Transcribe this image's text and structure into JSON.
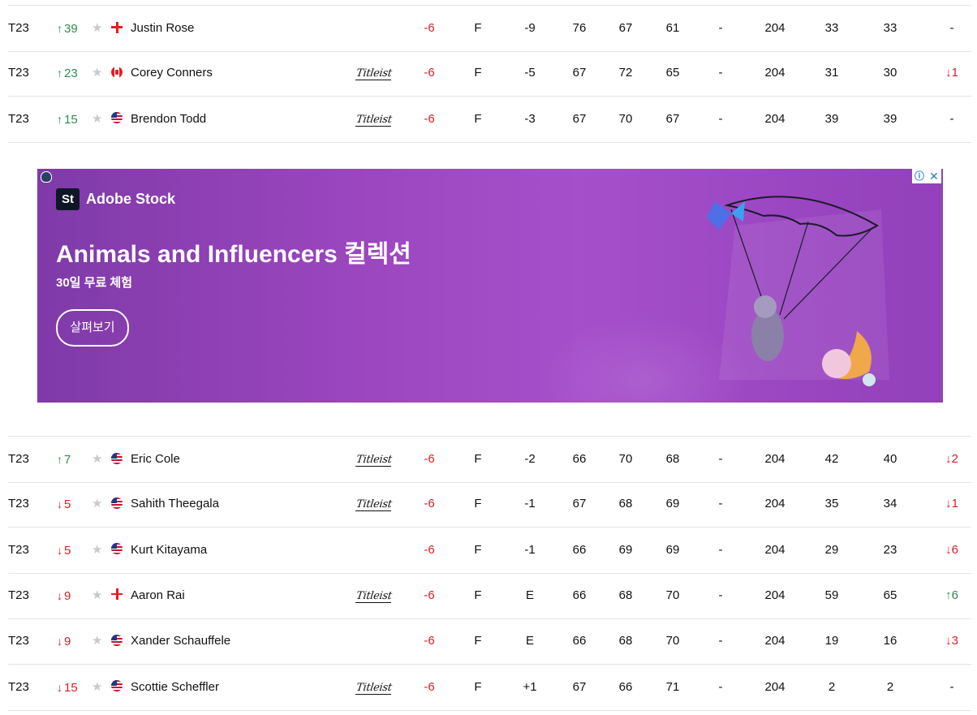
{
  "rows_top": [
    {
      "pos": "T23",
      "move_dir": "up",
      "move": "39",
      "flag": "england",
      "name": "Justin Rose",
      "titleist": false,
      "tot": "-6",
      "thru": "F",
      "today": "-9",
      "r1": "76",
      "r2": "67",
      "r3": "61",
      "r4": "-",
      "strokes": "204",
      "proj": "33",
      "start": "33",
      "fedex_dir": "none",
      "fedex": "-"
    },
    {
      "pos": "T23",
      "move_dir": "up",
      "move": "23",
      "flag": "canada",
      "name": "Corey Conners",
      "titleist": true,
      "tot": "-6",
      "thru": "F",
      "today": "-5",
      "r1": "67",
      "r2": "72",
      "r3": "65",
      "r4": "-",
      "strokes": "204",
      "proj": "31",
      "start": "30",
      "fedex_dir": "down",
      "fedex": "1"
    },
    {
      "pos": "T23",
      "move_dir": "up",
      "move": "15",
      "flag": "usa",
      "name": "Brendon Todd",
      "titleist": true,
      "tot": "-6",
      "thru": "F",
      "today": "-3",
      "r1": "67",
      "r2": "70",
      "r3": "67",
      "r4": "-",
      "strokes": "204",
      "proj": "39",
      "start": "39",
      "fedex_dir": "none",
      "fedex": "-"
    }
  ],
  "rows_bottom": [
    {
      "pos": "T23",
      "move_dir": "up",
      "move": "7",
      "flag": "usa",
      "name": "Eric Cole",
      "titleist": true,
      "tot": "-6",
      "thru": "F",
      "today": "-2",
      "r1": "66",
      "r2": "70",
      "r3": "68",
      "r4": "-",
      "strokes": "204",
      "proj": "42",
      "start": "40",
      "fedex_dir": "down",
      "fedex": "2"
    },
    {
      "pos": "T23",
      "move_dir": "down",
      "move": "5",
      "flag": "usa",
      "name": "Sahith Theegala",
      "titleist": true,
      "tot": "-6",
      "thru": "F",
      "today": "-1",
      "r1": "67",
      "r2": "68",
      "r3": "69",
      "r4": "-",
      "strokes": "204",
      "proj": "35",
      "start": "34",
      "fedex_dir": "down",
      "fedex": "1"
    },
    {
      "pos": "T23",
      "move_dir": "down",
      "move": "5",
      "flag": "usa",
      "name": "Kurt Kitayama",
      "titleist": false,
      "tot": "-6",
      "thru": "F",
      "today": "-1",
      "r1": "66",
      "r2": "69",
      "r3": "69",
      "r4": "-",
      "strokes": "204",
      "proj": "29",
      "start": "23",
      "fedex_dir": "down",
      "fedex": "6"
    },
    {
      "pos": "T23",
      "move_dir": "down",
      "move": "9",
      "flag": "england",
      "name": "Aaron Rai",
      "titleist": true,
      "tot": "-6",
      "thru": "F",
      "today": "E",
      "r1": "66",
      "r2": "68",
      "r3": "70",
      "r4": "-",
      "strokes": "204",
      "proj": "59",
      "start": "65",
      "fedex_dir": "up",
      "fedex": "6"
    },
    {
      "pos": "T23",
      "move_dir": "down",
      "move": "9",
      "flag": "usa",
      "name": "Xander Schauffele",
      "titleist": false,
      "tot": "-6",
      "thru": "F",
      "today": "E",
      "r1": "66",
      "r2": "68",
      "r3": "70",
      "r4": "-",
      "strokes": "204",
      "proj": "19",
      "start": "16",
      "fedex_dir": "down",
      "fedex": "3"
    },
    {
      "pos": "T23",
      "move_dir": "down",
      "move": "15",
      "flag": "usa",
      "name": "Scottie Scheffler",
      "titleist": true,
      "tot": "-6",
      "thru": "F",
      "today": "+1",
      "r1": "67",
      "r2": "66",
      "r3": "71",
      "r4": "-",
      "strokes": "204",
      "proj": "2",
      "start": "2",
      "fedex_dir": "none",
      "fedex": "-"
    }
  ],
  "sponsor_logo_text": "Titleist",
  "star_glyph": "★",
  "arrows": {
    "up": "↑",
    "down": "↓"
  },
  "colors": {
    "up": "#2f8a4f",
    "down": "#d61f26",
    "score_red": "#d61f26"
  },
  "ad": {
    "brand_badge": "St",
    "brand": "Adobe Stock",
    "headline": "Animals and Influencers 컬렉션",
    "subline": "30일 무료 체험",
    "cta": "살펴보기",
    "info_icon": "ⓘ",
    "close_icon": "✕"
  }
}
